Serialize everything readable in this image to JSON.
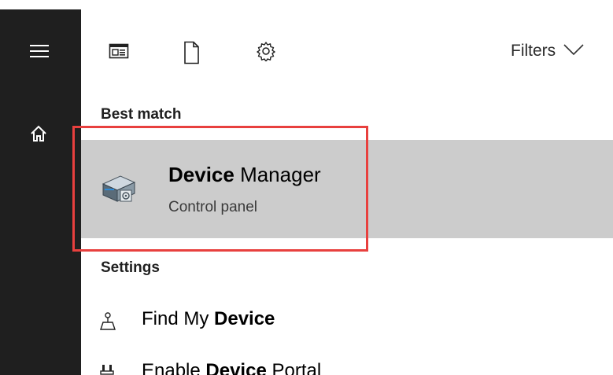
{
  "toolbar": {
    "icons": [
      "app-window-icon",
      "document-icon",
      "settings-gear-icon"
    ],
    "filters_label": "Filters"
  },
  "sidebar": {
    "icons": [
      "hamburger-menu-icon",
      "home-icon"
    ]
  },
  "sections": {
    "best_match": "Best match",
    "settings": "Settings"
  },
  "best_match_item": {
    "title_bold": "Device",
    "title_rest": " Manager",
    "subtitle": "Control panel",
    "icon": "device-manager-icon"
  },
  "settings_items": [
    {
      "prefix": "Find My ",
      "bold": "Device",
      "suffix": "",
      "icon": "find-device-icon"
    },
    {
      "prefix": "Enable ",
      "bold": "Device",
      "suffix": " Portal",
      "icon": "device-portal-icon"
    }
  ],
  "colors": {
    "sidebar": "#1f1f1f",
    "selected_row": "#cccccc",
    "highlight_border": "#e8403e"
  }
}
